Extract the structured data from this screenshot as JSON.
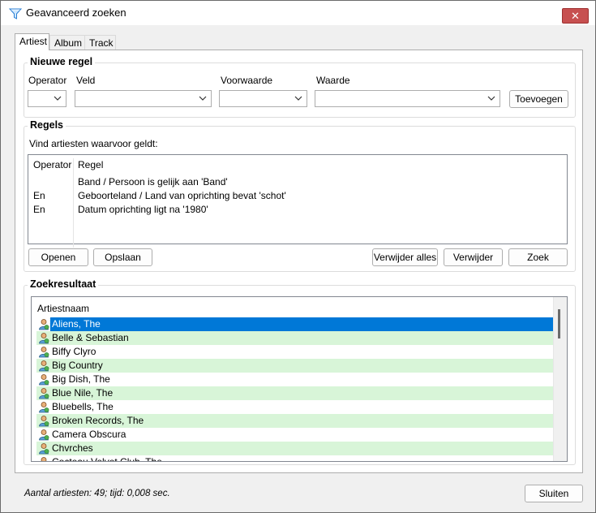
{
  "window": {
    "title": "Geavanceerd zoeken",
    "close_glyph": "✕"
  },
  "tabs": [
    {
      "label": "Artiest",
      "active": true
    },
    {
      "label": "Album",
      "active": false
    },
    {
      "label": "Track",
      "active": false
    }
  ],
  "new_rule": {
    "title": "Nieuwe regel",
    "operator_label": "Operator",
    "field_label": "Veld",
    "condition_label": "Voorwaarde",
    "value_label": "Waarde",
    "operator_value": "",
    "field_value": "",
    "condition_value": "",
    "value_value": "",
    "add_button": "Toevoegen"
  },
  "rules": {
    "title": "Regels",
    "description": "Vind artiesten waarvoor geldt:",
    "columns": {
      "operator": "Operator",
      "rule": "Regel"
    },
    "items": [
      {
        "operator": "",
        "rule": "Band / Persoon is gelijk aan 'Band'"
      },
      {
        "operator": "En",
        "rule": "Geboorteland / Land van oprichting bevat 'schot'"
      },
      {
        "operator": "En",
        "rule": "Datum oprichting ligt na '1980'"
      }
    ],
    "open_button": "Openen",
    "save_button": "Opslaan",
    "remove_all_button": "Verwijder alles",
    "remove_button": "Verwijder",
    "search_button": "Zoek"
  },
  "results": {
    "title": "Zoekresultaat",
    "column": "Artiestnaam",
    "items": [
      {
        "name": "Aliens, The",
        "selected": true
      },
      {
        "name": "Belle & Sebastian",
        "selected": false
      },
      {
        "name": "Biffy Clyro",
        "selected": false
      },
      {
        "name": "Big Country",
        "selected": false
      },
      {
        "name": "Big Dish, The",
        "selected": false
      },
      {
        "name": "Blue Nile, The",
        "selected": false
      },
      {
        "name": "Bluebells, The",
        "selected": false
      },
      {
        "name": "Broken Records, The",
        "selected": false
      },
      {
        "name": "Camera Obscura",
        "selected": false
      },
      {
        "name": "Chvrches",
        "selected": false
      },
      {
        "name": "Cocteau Velvet Club, The",
        "selected": false
      }
    ],
    "icon": "person-icon"
  },
  "status": {
    "text": "Aantal artiesten: 49; tijd: 0,008 sec."
  },
  "close_button": "Sluiten",
  "colors": {
    "selected_bg": "#0078d7",
    "alt_row_bg": "#d8f5d8",
    "close_red": "#c75050"
  }
}
